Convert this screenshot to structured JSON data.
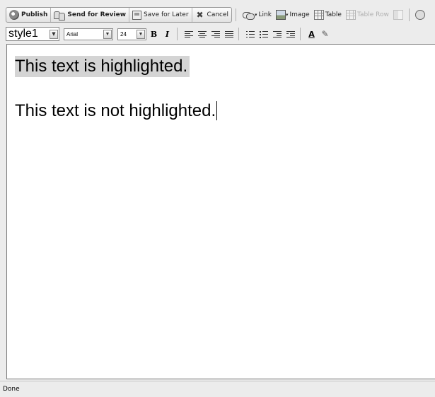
{
  "toolbar": {
    "publish_label": "Publish",
    "send_review_label": "Send for Review",
    "save_later_label": "Save for Later",
    "cancel_label": "Cancel",
    "link_label": "Link",
    "image_label": "Image",
    "table_label": "Table",
    "table_row_label": "Table Row"
  },
  "format_bar": {
    "style_value": "style1",
    "font_value": "Arial",
    "size_value": "24",
    "bold_label": "B",
    "italic_label": "I",
    "font_color_label": "A"
  },
  "editor": {
    "paragraph_1": "This text is highlighted.",
    "paragraph_2": "This text is not highlighted.",
    "highlight_color": "#d4d4d4"
  },
  "status": {
    "text": "Done"
  }
}
